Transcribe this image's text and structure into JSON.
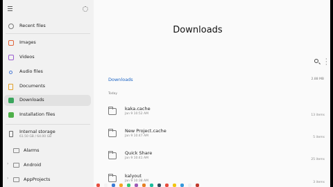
{
  "sidebar": {
    "items": [
      {
        "label": "Recent files",
        "color": "#7a7a7a"
      },
      {
        "label": "Images",
        "color": "#e0643a"
      },
      {
        "label": "Videos",
        "color": "#9a5cd0"
      },
      {
        "label": "Audio files",
        "color": "#4b7bd6"
      },
      {
        "label": "Documents",
        "color": "#e2a12a"
      },
      {
        "label": "Downloads",
        "color": "#3aa55d"
      },
      {
        "label": "Installation files",
        "color": "#4fb04a"
      }
    ],
    "storage": {
      "name": "Internal storage",
      "usage": "61.50 GB / 64.00 GB"
    },
    "tree": [
      {
        "label": "Alarms"
      },
      {
        "label": "Android"
      },
      {
        "label": "AppProjects"
      }
    ]
  },
  "main": {
    "title": "Downloads",
    "breadcrumb": "Downloads",
    "total_size": "2.88 MB",
    "section": "Today",
    "rows": [
      {
        "name": "kaka.cache",
        "date": "Jan 9 10:52 AM",
        "count": "13 items"
      },
      {
        "name": "New Project.cache",
        "date": "Jan 9 10:47 AM",
        "count": "5 items"
      },
      {
        "name": "Quick Share",
        "date": "Jan 9 10:41 AM",
        "count": "25 items"
      },
      {
        "name": "kalyout",
        "date": "Jan 9 10:38 AM",
        "count": "3 items"
      }
    ]
  },
  "colors": {
    "accent": "#1a63c4",
    "active_bg": "#e2e2e2"
  },
  "dock_colors": [
    "#e84d3d",
    "#f2f2f2",
    "#3a7bd5",
    "#f5a623",
    "#2ecc71",
    "#9b59b6",
    "#e67e22",
    "#1abc9c",
    "#34495e",
    "#e74c3c",
    "#f1c40f",
    "#3498db",
    "#ecf0f1",
    "#c0392b"
  ]
}
